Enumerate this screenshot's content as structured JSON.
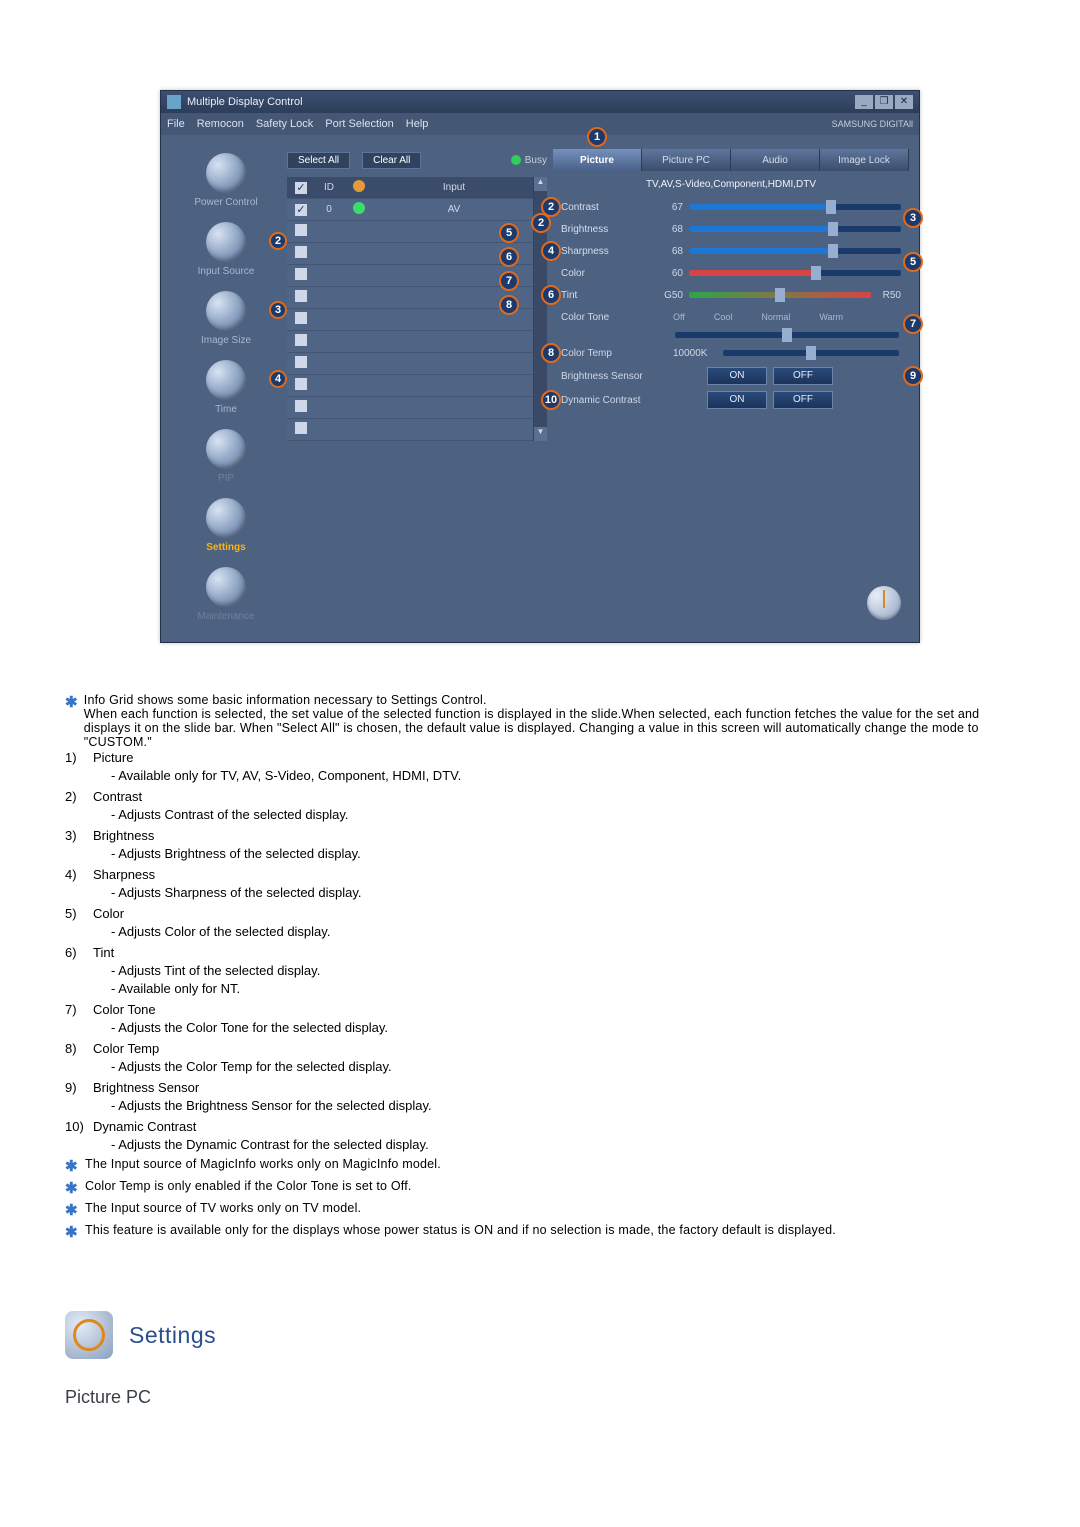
{
  "app": {
    "title": "Multiple Display Control",
    "brand": "SAMSUNG DIGITAll"
  },
  "win": {
    "min": "_",
    "max": "❐",
    "close": "✕"
  },
  "menu": [
    "File",
    "Remocon",
    "Safety Lock",
    "Port Selection",
    "Help"
  ],
  "sidenav": {
    "items": [
      {
        "label": "Power Control"
      },
      {
        "label": "Input Source"
      },
      {
        "label": "Image Size"
      },
      {
        "label": "Time"
      },
      {
        "label": "PIP"
      },
      {
        "label": "Settings"
      },
      {
        "label": "Maintenance"
      }
    ]
  },
  "selrow": {
    "select_all": "Select All",
    "clear_all": "Clear All",
    "busy": "Busy"
  },
  "list": {
    "header": {
      "id": "ID",
      "input": "Input"
    },
    "rows": [
      {
        "checked": true,
        "id": "0",
        "status": "green",
        "input": "AV"
      },
      {
        "checked": false,
        "id": "",
        "status": "",
        "input": ""
      },
      {
        "checked": false,
        "id": "",
        "status": "",
        "input": ""
      },
      {
        "checked": false,
        "id": "",
        "status": "",
        "input": ""
      },
      {
        "checked": false,
        "id": "",
        "status": "",
        "input": ""
      },
      {
        "checked": false,
        "id": "",
        "status": "",
        "input": ""
      },
      {
        "checked": false,
        "id": "",
        "status": "",
        "input": ""
      },
      {
        "checked": false,
        "id": "",
        "status": "",
        "input": ""
      },
      {
        "checked": false,
        "id": "",
        "status": "",
        "input": ""
      },
      {
        "checked": false,
        "id": "",
        "status": "",
        "input": ""
      },
      {
        "checked": false,
        "id": "",
        "status": "",
        "input": ""
      }
    ]
  },
  "tabs": [
    "Picture",
    "Picture PC",
    "Audio",
    "Image Lock"
  ],
  "panel": {
    "subheader": "TV,AV,S-Video,Component,HDMI,DTV",
    "contrast": {
      "label": "Contrast",
      "value": "67",
      "pct": 67
    },
    "brightness": {
      "label": "Brightness",
      "value": "68",
      "pct": 68
    },
    "sharpness": {
      "label": "Sharpness",
      "value": "68",
      "pct": 68
    },
    "color": {
      "label": "Color",
      "value": "60",
      "pct": 60
    },
    "tint": {
      "label": "Tint",
      "left": "G50",
      "right": "R50",
      "pct": 50
    },
    "colortone": {
      "label": "Color Tone",
      "options": [
        "Off",
        "Cool",
        "Normal",
        "Warm"
      ],
      "pct": 50
    },
    "colortemp": {
      "label": "Color Temp",
      "value": "10000K",
      "pct": 50
    },
    "brightness_sensor": {
      "label": "Brightness Sensor",
      "on": "ON",
      "off": "OFF"
    },
    "dynamic_contrast": {
      "label": "Dynamic Contrast",
      "on": "ON",
      "off": "OFF"
    }
  },
  "explain": {
    "intro": "Info Grid shows some basic information necessary to Settings Control.",
    "intro_more": "When each function is selected, the set value of the selected function is displayed in the slide.When selected, each function fetches the value for the set and displays it on the slide bar. When \"Select All\" is chosen, the default value is displayed. Changing a value in this screen will automatically change the mode to \"CUSTOM.\"",
    "items": [
      {
        "n": "1)",
        "title": "Picture",
        "lines": [
          "- Available only for TV, AV, S-Video, Component, HDMI, DTV."
        ]
      },
      {
        "n": "2)",
        "title": "Contrast",
        "lines": [
          "- Adjusts Contrast of the selected display."
        ]
      },
      {
        "n": "3)",
        "title": "Brightness",
        "lines": [
          "- Adjusts Brightness of the selected display."
        ]
      },
      {
        "n": "4)",
        "title": "Sharpness",
        "lines": [
          "- Adjusts Sharpness of the selected display."
        ]
      },
      {
        "n": "5)",
        "title": "Color",
        "lines": [
          "- Adjusts Color of the selected display."
        ]
      },
      {
        "n": "6)",
        "title": "Tint",
        "lines": [
          "- Adjusts Tint of the selected display.",
          "- Available  only for NT."
        ]
      },
      {
        "n": "7)",
        "title": "Color Tone",
        "lines": [
          "- Adjusts the Color Tone for the selected display."
        ]
      },
      {
        "n": "8)",
        "title": "Color Temp",
        "lines": [
          "- Adjusts the Color Temp for the selected display."
        ]
      },
      {
        "n": "9)",
        "title": "Brightness Sensor",
        "lines": [
          "- Adjusts the Brightness Sensor for the selected display."
        ]
      },
      {
        "n": "10)",
        "title": "Dynamic Contrast",
        "lines": [
          "- Adjusts the Dynamic Contrast for the selected display."
        ]
      }
    ],
    "notes": [
      "The Input source of MagicInfo works only on MagicInfo model.",
      "Color Temp is only enabled if the Color Tone is set to Off.",
      "The Input source of TV works only on TV model.",
      "This feature is available only for the displays whose power status is ON and if no selection is made, the factory default is displayed."
    ]
  },
  "section": {
    "title": "Settings",
    "sub": "Picture PC"
  },
  "callouts": {
    "c1": "1",
    "c2": "2",
    "c3": "3",
    "c4": "4",
    "c5": "5",
    "c6": "6",
    "c7": "7",
    "c8": "8",
    "c9": "9",
    "c10": "10"
  }
}
